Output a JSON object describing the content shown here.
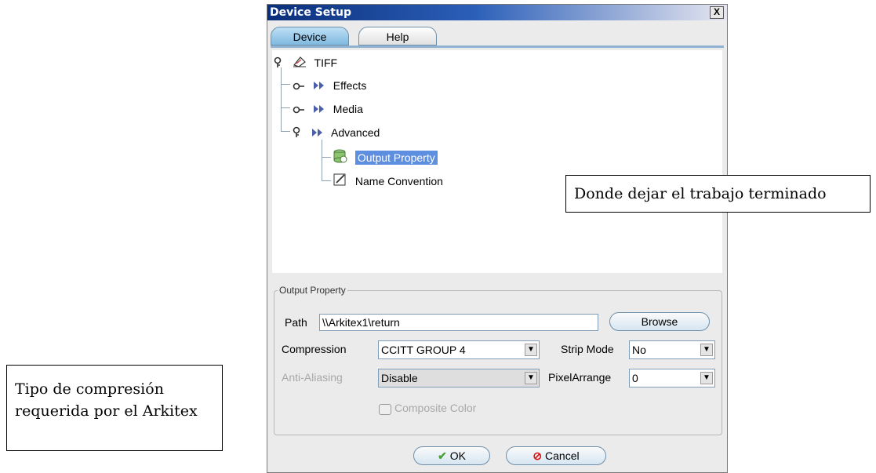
{
  "window": {
    "title": "Device Setup",
    "close_label": "X"
  },
  "tabs": [
    {
      "label": "Device"
    },
    {
      "label": "Help"
    }
  ],
  "tree": {
    "root": "TIFF",
    "items": [
      {
        "label": "Effects"
      },
      {
        "label": "Media"
      },
      {
        "label": "Advanced"
      }
    ],
    "advanced_children": [
      {
        "label": "Output Property"
      },
      {
        "label": "Name Convention"
      }
    ]
  },
  "output_property": {
    "legend": "Output Property",
    "path_label": "Path",
    "path_value": "\\\\Arkitex1\\return",
    "browse_label": "Browse",
    "compression_label": "Compression",
    "compression_value": "CCITT GROUP 4",
    "strip_mode_label": "Strip Mode",
    "strip_mode_value": "No",
    "anti_aliasing_label": "Anti-Aliasing",
    "anti_aliasing_value": "Disable",
    "pixel_arrange_label": "PixelArrange",
    "pixel_arrange_value": "0",
    "composite_color_label": "Composite Color"
  },
  "buttons": {
    "ok_label": "OK",
    "cancel_label": "Cancel"
  },
  "callouts": {
    "output_location": "Donde dejar el trabajo terminado",
    "compression_note": "Tipo de compresión requerida por el Arkitex"
  }
}
